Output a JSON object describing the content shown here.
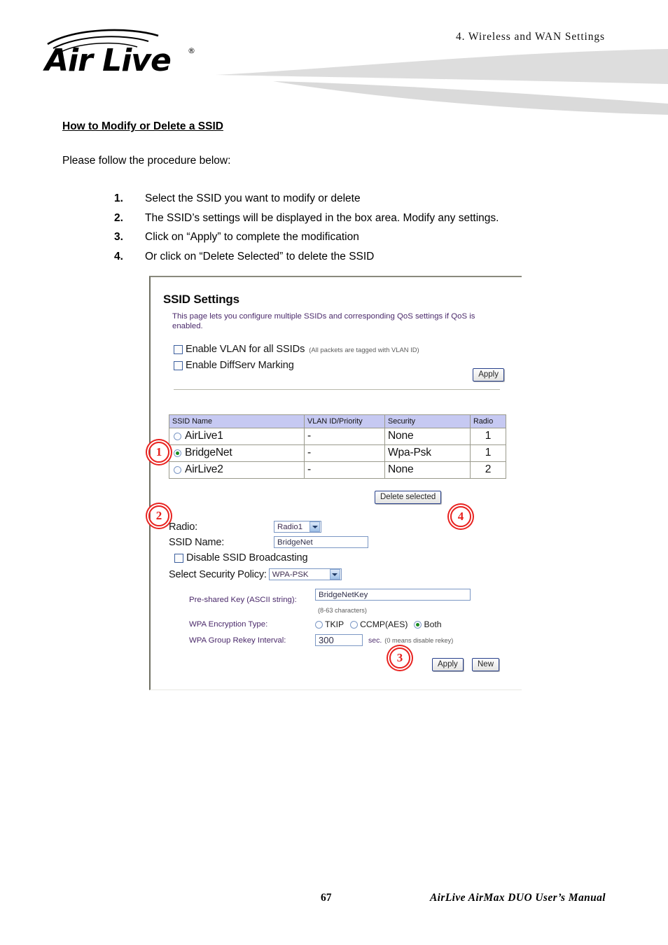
{
  "header": {
    "chapter_title": "4.  Wireless  and  WAN  Settings",
    "logo_text": "AirLive",
    "logo_trademark": "®"
  },
  "document": {
    "section_heading": "How to Modify or Delete a SSID ",
    "intro": "Please follow the procedure below:",
    "steps": [
      {
        "number": "1.",
        "text": "Select the SSID you want to modify or delete"
      },
      {
        "number": "2.",
        "text": "The SSID’s settings will be displayed in the box area. Modify any settings."
      },
      {
        "number": "3.",
        "text": "Click on “Apply” to complete the modification"
      },
      {
        "number": "4.",
        "text": "Or click on “Delete Selected” to delete the SSID"
      }
    ]
  },
  "ui_panel": {
    "title": "SSID Settings",
    "description": "This page lets you configure multiple SSIDs and corresponding QoS settings if QoS is enabled.",
    "checkboxes": [
      {
        "label": "Enable VLAN for all SSIDs",
        "note": "(All packets are tagged with VLAN ID)",
        "checked": false
      },
      {
        "label": "Enable DiffServ Marking",
        "note": "",
        "checked": false
      }
    ],
    "apply_top_label": "Apply",
    "table": {
      "columns": [
        "SSID Name",
        "VLAN ID/Priority",
        "Security",
        "Radio"
      ],
      "rows": [
        {
          "selected": false,
          "name": "AirLive1",
          "vlan": "-",
          "security": "None",
          "radio": "1"
        },
        {
          "selected": true,
          "name": "BridgeNet",
          "vlan": "-",
          "security": "Wpa-Psk",
          "radio": "1"
        },
        {
          "selected": false,
          "name": "AirLive2",
          "vlan": "-",
          "security": "None",
          "radio": "2"
        }
      ]
    },
    "delete_selected_label": "Delete selected",
    "form": {
      "radio_label": "Radio:",
      "radio_value": "Radio1",
      "ssid_name_label": "SSID Name:",
      "ssid_name_value": "BridgeNet",
      "disable_broadcast_label": "Disable SSID Broadcasting",
      "disable_broadcast_checked": false,
      "security_policy_label": "Select Security Policy:",
      "security_policy_value": "WPA-PSK",
      "psk_label": "Pre-shared Key (ASCII string):",
      "psk_value": "BridgeNetKey",
      "psk_hint": "(8-63 characters)",
      "encryption_label": "WPA Encryption Type:",
      "encryption_options": [
        {
          "label": "TKIP",
          "selected": false
        },
        {
          "label": "CCMP(AES)",
          "selected": false
        },
        {
          "label": "Both",
          "selected": true
        }
      ],
      "rekey_label": "WPA Group Rekey Interval:",
      "rekey_value": "300",
      "rekey_unit": "sec.",
      "rekey_note": "(0 means disable rekey)",
      "apply_label": "Apply",
      "new_label": "New"
    }
  },
  "annotations": [
    {
      "number": "1"
    },
    {
      "number": "2"
    },
    {
      "number": "3"
    },
    {
      "number": "4"
    }
  ],
  "footer": {
    "page_number": "67",
    "manual_title": "AirLive  AirMax  DUO  User’s  Manual"
  },
  "colors": {
    "annotation_red": "#e8221f",
    "table_header_blue": "#c6c9f2",
    "radio_selected_green": "#178a1e",
    "field_border_blue": "#7b97c4",
    "description_purple": "#4b2a6b"
  }
}
